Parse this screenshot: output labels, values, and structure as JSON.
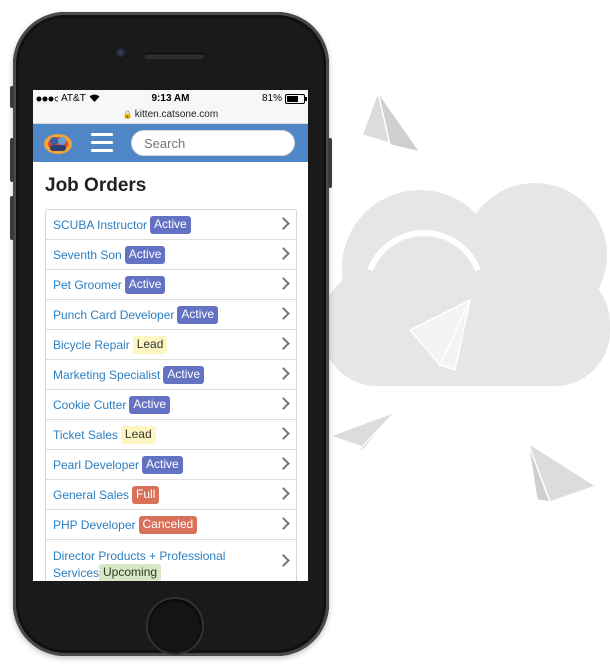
{
  "status_bar": {
    "carrier": "AT&T",
    "time": "9:13 AM",
    "battery": "81%",
    "battery_level": 0.81
  },
  "url_bar": {
    "url": "kitten.catsone.com"
  },
  "header": {
    "search_placeholder": "Search"
  },
  "page_title": "Job Orders",
  "job_orders": [
    {
      "title": "SCUBA Instructor",
      "status": "Active"
    },
    {
      "title": "Seventh Son",
      "status": "Active"
    },
    {
      "title": "Pet Groomer",
      "status": "Active"
    },
    {
      "title": "Punch Card Developer",
      "status": "Active"
    },
    {
      "title": "Bicycle Repair",
      "status": "Lead"
    },
    {
      "title": "Marketing Specialist",
      "status": "Active"
    },
    {
      "title": "Cookie Cutter",
      "status": "Active"
    },
    {
      "title": "Ticket Sales",
      "status": "Lead"
    },
    {
      "title": "Pearl Developer",
      "status": "Active"
    },
    {
      "title": "General Sales",
      "status": "Full"
    },
    {
      "title": "PHP Developer",
      "status": "Canceled"
    },
    {
      "title_line1": "Director Products + Professional",
      "title_line2": "Services",
      "status": "Upcoming"
    }
  ],
  "colors": {
    "header_blue": "#4f86c6",
    "link_blue": "#2a7fc2",
    "active_badge": "#6472c4",
    "lead_badge": "#fdf6c0",
    "full_badge": "#d9705a",
    "canceled_badge": "#d9705a",
    "upcoming_badge": "#d7e8c6",
    "background_art": "#e6e6e6"
  },
  "icons": [
    "signal-icon",
    "wifi-icon",
    "battery-icon",
    "lock-icon",
    "app-logo-icon",
    "hamburger-menu-icon",
    "chevron-right-icon",
    "cloud-icon",
    "paper-plane-icon"
  ]
}
